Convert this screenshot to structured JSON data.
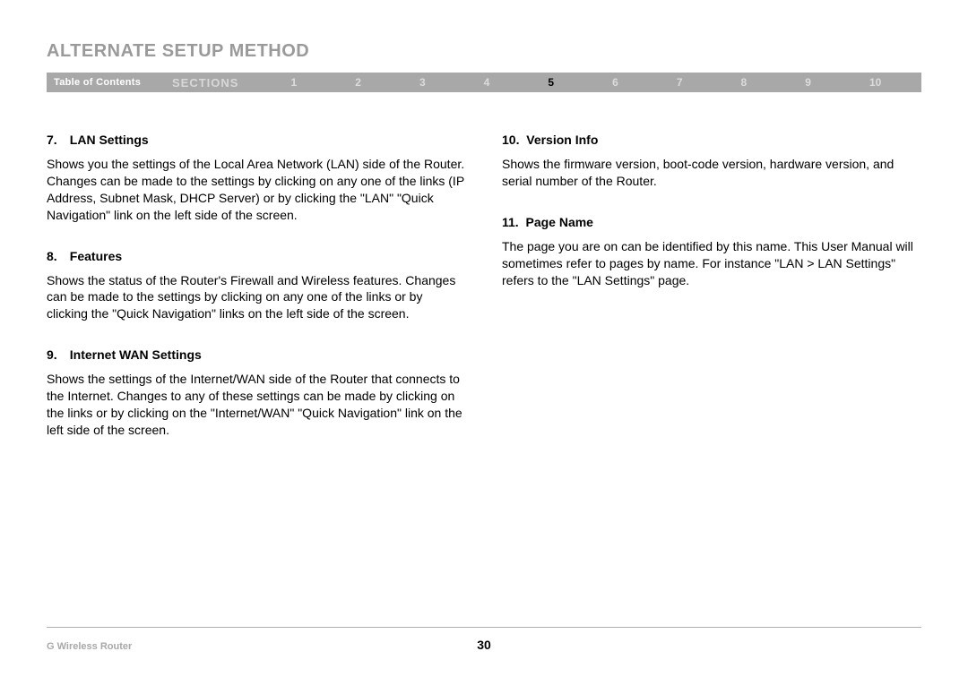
{
  "header": {
    "title": "ALTERNATE SETUP METHOD"
  },
  "nav": {
    "toc": "Table of Contents",
    "sections_label": "SECTIONS",
    "numbers": [
      "1",
      "2",
      "3",
      "4",
      "5",
      "6",
      "7",
      "8",
      "9",
      "10"
    ],
    "active_index": 4
  },
  "left_column": [
    {
      "num": "7.",
      "title": "LAN Settings",
      "body": "Shows you the settings of the Local Area Network (LAN) side of the Router. Changes can be made to the settings by clicking on any one of the links (IP Address, Subnet Mask, DHCP Server) or by clicking the \"LAN\" \"Quick Navigation\" link on the left side of the screen."
    },
    {
      "num": "8.",
      "title": "Features",
      "body": "Shows the status of the Router's Firewall and Wireless features. Changes can be made to the settings by clicking on any one of the links or by clicking the \"Quick Navigation\" links on the left side of the screen."
    },
    {
      "num": "9.",
      "title": "Internet WAN Settings",
      "body": "Shows the settings of the Internet/WAN side of the Router that connects to the Internet. Changes to any of these settings can be made by clicking on the links or by clicking on the \"Internet/WAN\" \"Quick Navigation\" link on the left side of the screen."
    }
  ],
  "right_column": [
    {
      "num": "10.",
      "title": "Version Info",
      "body": "Shows the firmware version, boot-code version, hardware version, and serial number of the Router."
    },
    {
      "num": "11.",
      "title": "Page Name",
      "body": "The page you are on can be identified by this name. This User Manual will sometimes refer to pages by name. For instance \"LAN > LAN Settings\" refers to the \"LAN Settings\" page."
    }
  ],
  "footer": {
    "product": "G Wireless Router",
    "page_number": "30"
  }
}
